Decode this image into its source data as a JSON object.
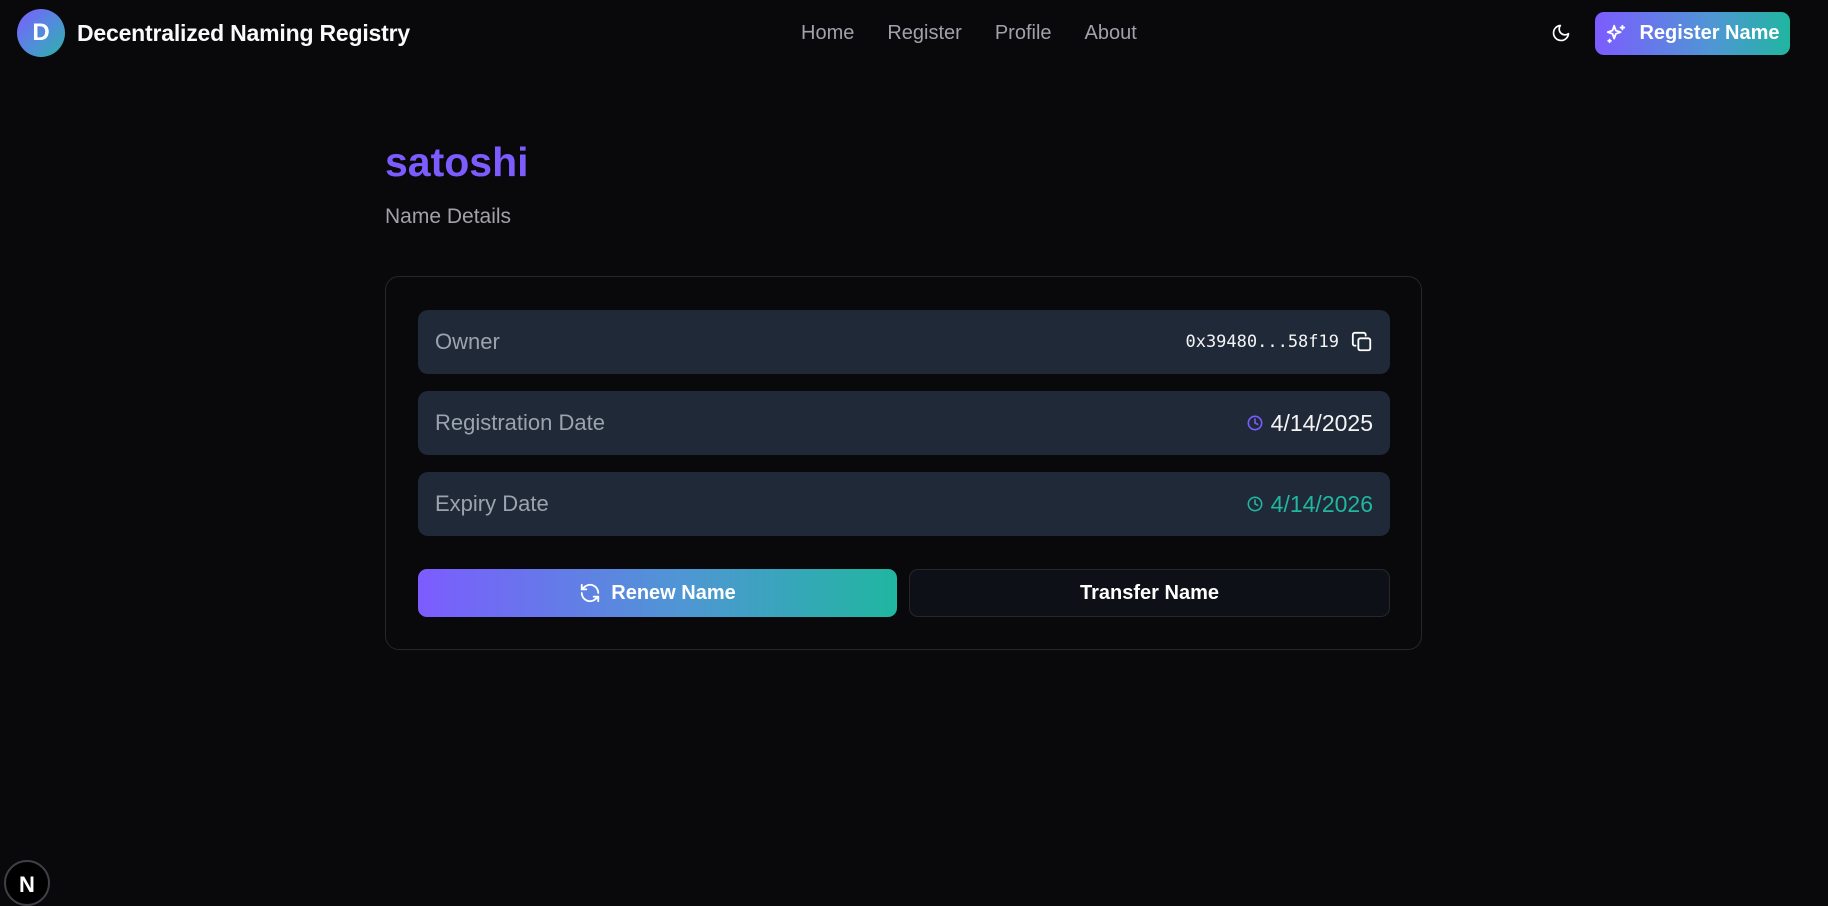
{
  "header": {
    "logo_letter": "D",
    "brand": "Decentralized Naming Registry",
    "nav": [
      "Home",
      "Register",
      "Profile",
      "About"
    ],
    "cta_label": "Register Name"
  },
  "page": {
    "title": "satoshi",
    "subtitle": "Name Details"
  },
  "details": {
    "owner_label": "Owner",
    "owner_value": "0x39480...58f19",
    "registration_label": "Registration Date",
    "registration_value": "4/14/2025",
    "expiry_label": "Expiry Date",
    "expiry_value": "4/14/2026"
  },
  "actions": {
    "renew_label": "Renew Name",
    "transfer_label": "Transfer Name"
  },
  "badge": {
    "letter": "N"
  },
  "colors": {
    "accent_purple": "#7c5cff",
    "accent_teal": "#20b6a0",
    "background": "#09090b",
    "row_background": "#1f2937"
  }
}
